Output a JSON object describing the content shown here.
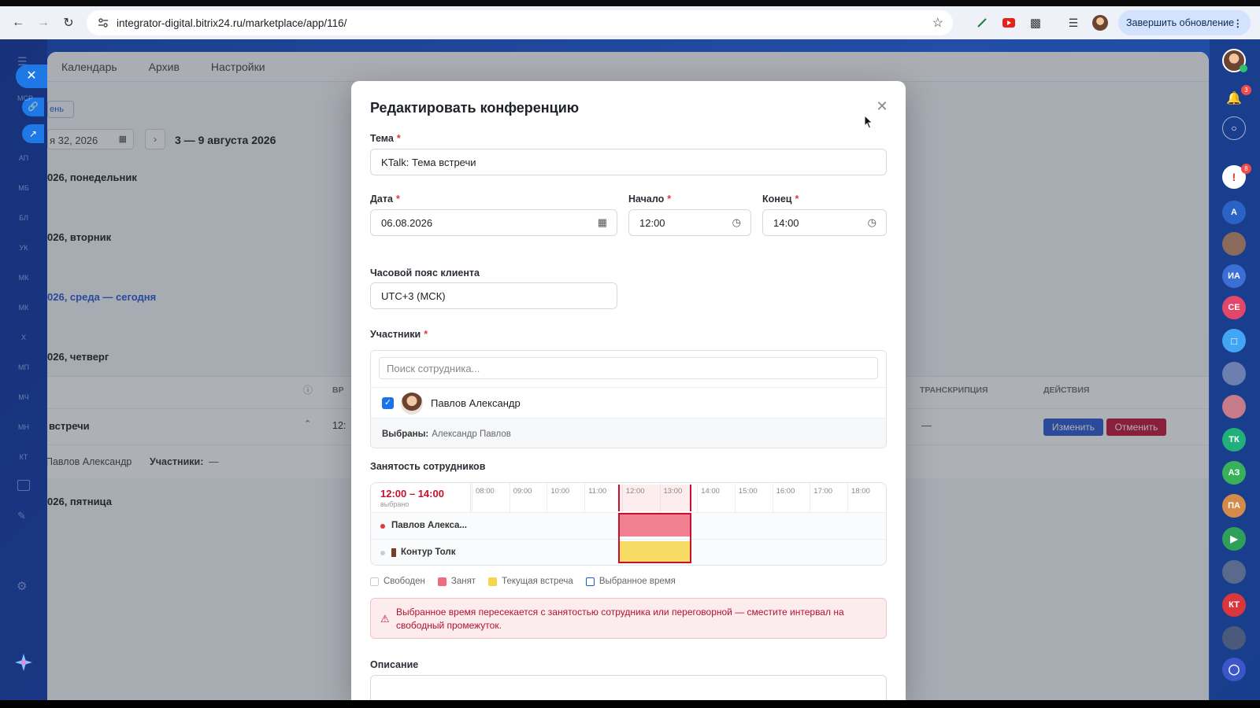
{
  "browser": {
    "url": "integrator-digital.bitrix24.ru/marketplace/app/116/",
    "update_button": "Завершить обновление"
  },
  "app": {
    "nav": [
      "Календарь",
      "Архив",
      "Настройки"
    ],
    "toolbar": {
      "day_btn": "ень",
      "date_input": "я 32, 2026",
      "week_range": "3 — 9 августа 2026"
    },
    "days": [
      "026, понедельник",
      "026, вторник",
      "026, среда — сегодня",
      "026, четверг",
      "026, пятница"
    ],
    "table": {
      "col_time": "ВР",
      "col_transcript": "ТРАНСКРИПЦИЯ",
      "col_actions": "ДЕЙСТВИЯ",
      "row_title": "встречи",
      "row_time": "12:",
      "row_transcript": "—",
      "row_person": "Павлов Александр",
      "row_participants_label": "Участники:",
      "row_participants_value": "—",
      "edit_btn": "Изменить",
      "cancel_btn": "Отменить"
    }
  },
  "left_sidebar": [
    "МСР",
    "АП",
    "МБ",
    "БЛ",
    "УК",
    "МК",
    "МК",
    "Х",
    "МП",
    "МЧ",
    "МН",
    "КТ"
  ],
  "right_sidebar": {
    "notifications_badge": "3",
    "alert_badge": "8",
    "avatars": [
      "А",
      "ИА",
      "СЕ",
      "ТК",
      "АЗ",
      "ПА",
      "КТ"
    ]
  },
  "modal": {
    "title": "Редактировать конференцию",
    "topic_label": "Тема",
    "topic_value": "KTalk: Тема встречи",
    "date_label": "Дата",
    "date_value": "06.08.2026",
    "start_label": "Начало",
    "start_value": "12:00",
    "end_label": "Конец",
    "end_value": "14:00",
    "tz_label": "Часовой пояс клиента",
    "tz_value": "UTC+3 (МСК)",
    "participants_label": "Участники",
    "search_placeholder": "Поиск сотрудника...",
    "participant_name": "Павлов Александр",
    "selected_label": "Выбраны:",
    "selected_value": "Александр Павлов",
    "busy_label": "Занятость сотрудников",
    "busy_selected_range": "12:00 – 14:00",
    "busy_selected_sub": "выбрано",
    "hours": [
      "08:00",
      "09:00",
      "10:00",
      "11:00",
      "12:00",
      "13:00",
      "14:00",
      "15:00",
      "16:00",
      "17:00",
      "18:00"
    ],
    "rows": [
      {
        "name": "Павлов Алекса...",
        "dot_color": "#e0393e"
      },
      {
        "name": "Контур Толк",
        "dot_color": "#c8cdd3"
      }
    ],
    "legend": [
      {
        "label": "Свободен",
        "color": "#ffffff"
      },
      {
        "label": "Занят",
        "color": "#ef6b7e"
      },
      {
        "label": "Текущая встреча",
        "color": "#f5d54a"
      },
      {
        "label": "Выбранное время",
        "color": "#1a56db"
      }
    ],
    "alert_text": "Выбранное время пересекается с занятостью сотрудника или переговорной — сместите интервал на свободный промежуток.",
    "description_label": "Описание"
  },
  "colors": {
    "accent": "#1a73e8",
    "danger": "#c8102e",
    "edit_btn": "#2f5bd3",
    "cancel_btn": "#c5163a"
  }
}
